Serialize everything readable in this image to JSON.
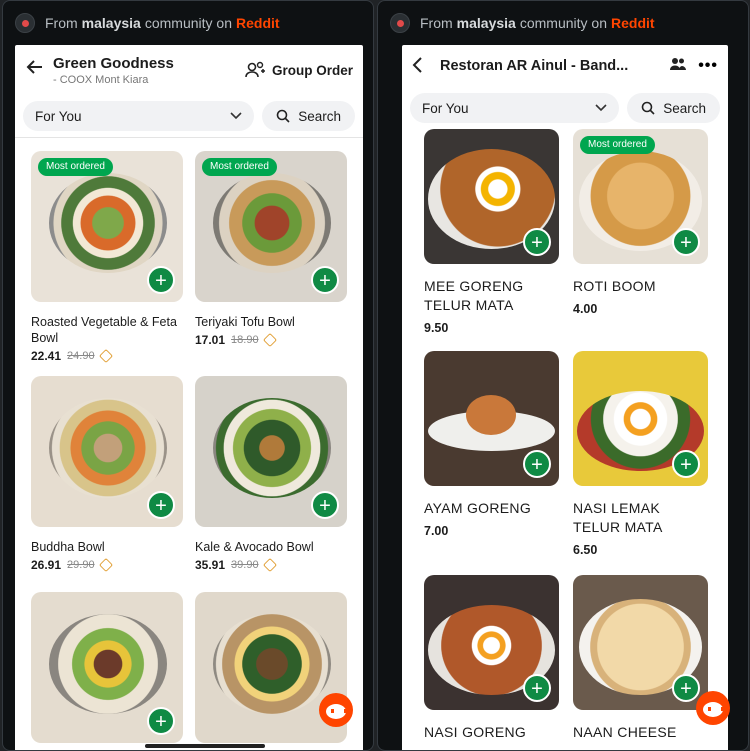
{
  "reddit": {
    "prefix": "From",
    "community": "malaysia",
    "middle": "community on",
    "site": "Reddit"
  },
  "left": {
    "title": "Green Goodness",
    "subtitle": "- COOX Mont Kiara",
    "group_order": "Group Order",
    "filter": "For You",
    "search": "Search",
    "items": [
      {
        "name": "Roasted Vegetable & Feta Bowl",
        "price": "22.41",
        "old_price": "24.90",
        "badge": "Most ordered"
      },
      {
        "name": "Teriyaki Tofu Bowl",
        "price": "17.01",
        "old_price": "18.90",
        "badge": "Most ordered"
      },
      {
        "name": "Buddha Bowl",
        "price": "26.91",
        "old_price": "29.90",
        "badge": ""
      },
      {
        "name": "Kale & Avocado Bowl",
        "price": "35.91",
        "old_price": "39.90",
        "badge": ""
      }
    ]
  },
  "right": {
    "title": "Restoran AR Ainul - Band...",
    "filter": "For You",
    "search": "Search",
    "items": [
      {
        "name": "MEE GORENG TELUR MATA",
        "price": "9.50",
        "badge": ""
      },
      {
        "name": "ROTI BOOM",
        "price": "4.00",
        "badge": "Most ordered"
      },
      {
        "name": "AYAM GORENG",
        "price": "7.00",
        "badge": ""
      },
      {
        "name": "NASI LEMAK TELUR MATA",
        "price": "6.50",
        "badge": ""
      },
      {
        "name": "NASI GORENG",
        "price": "",
        "badge": ""
      },
      {
        "name": "NAAN CHEESE",
        "price": "",
        "badge": ""
      }
    ]
  },
  "colors": {
    "accent_green": "#0f8a44",
    "badge_green": "#00a64f",
    "reddit_orange": "#ff4500"
  }
}
